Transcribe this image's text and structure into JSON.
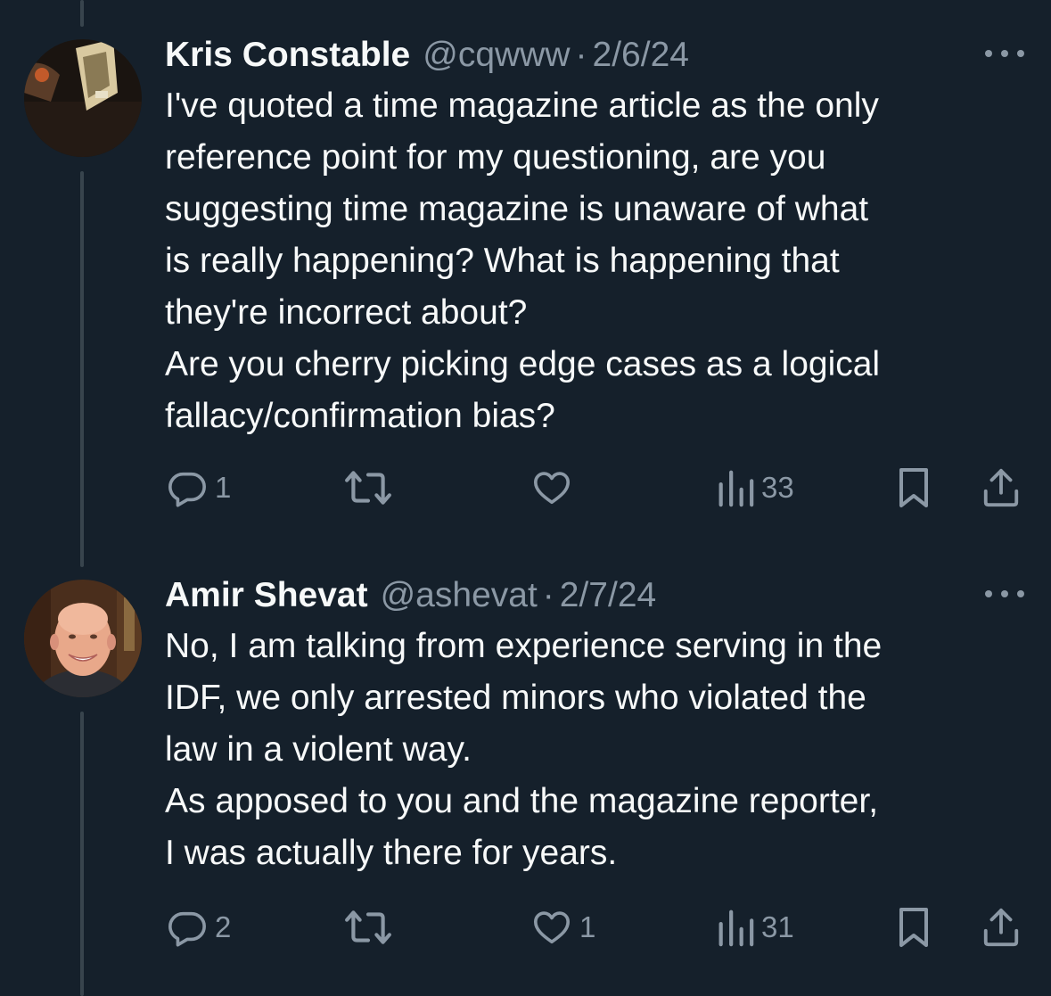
{
  "tweets": [
    {
      "name": "Kris Constable",
      "handle": "@cqwww",
      "separator": "·",
      "date": "2/6/24",
      "avatar": "profile-photo-dark",
      "text": "I've quoted a time magazine article as the only\nreference point for my questioning, are you\nsuggesting time magazine is unaware of what\nis really happening? What is happening that\nthey're incorrect about?\nAre you cherry picking edge cases as a logical\nfallacy/confirmation bias?",
      "replies": "1",
      "retweets": "",
      "likes": "",
      "views": "33"
    },
    {
      "name": "Amir Shevat",
      "handle": "@ashevat",
      "separator": "·",
      "date": "2/7/24",
      "avatar": "profile-photo-smiling-man",
      "text": "No, I am talking from experience serving in the\nIDF, we only arrested minors who violated the\nlaw in a violent way.\nAs apposed to you and the magazine reporter,\nI was actually there for years.",
      "replies": "2",
      "retweets": "",
      "likes": "1",
      "views": "31"
    }
  ],
  "icons": {
    "reply": "reply-icon",
    "retweet": "retweet-icon",
    "like": "heart-icon",
    "views": "views-icon",
    "bookmark": "bookmark-icon",
    "share": "share-icon",
    "more": "more-icon"
  },
  "colors": {
    "background": "#15202b",
    "text": "#f7f9f9",
    "secondary": "#8b98a5",
    "thread_line": "#38444d"
  }
}
